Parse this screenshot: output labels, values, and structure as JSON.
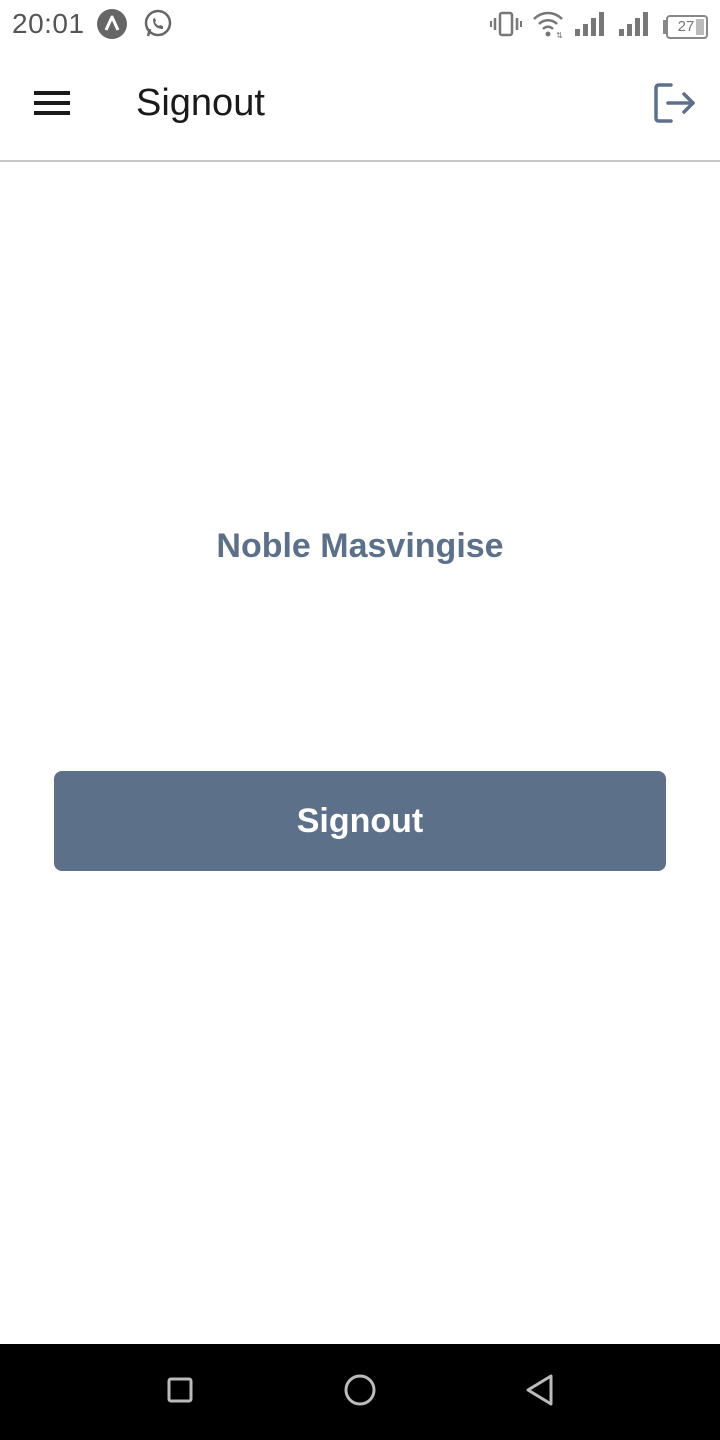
{
  "status_bar": {
    "time": "20:01",
    "battery_level": "27",
    "icons": [
      "autofill-icon",
      "whatsapp-icon",
      "vibrate-icon",
      "wifi-icon",
      "signal-icon",
      "signal-icon",
      "battery-icon"
    ]
  },
  "app_bar": {
    "title": "Signout",
    "menu_icon": "hamburger-menu-icon",
    "action_icon": "logout-icon"
  },
  "content": {
    "user_name": "Noble Masvingise",
    "signout_label": "Signout"
  },
  "nav_bar": {
    "buttons": [
      "recents-square-icon",
      "home-circle-icon",
      "back-triangle-icon"
    ]
  },
  "colors": {
    "accent": "#5d7089",
    "title_text": "#1a1a1a",
    "nav_background": "#000000"
  }
}
